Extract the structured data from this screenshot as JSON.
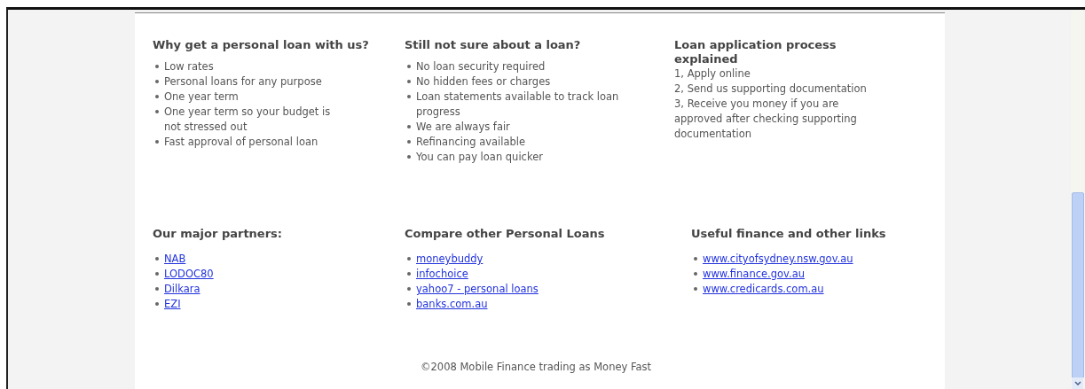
{
  "info_sections": [
    {
      "heading": "Why get a personal loan with us?",
      "kind": "bullets",
      "items": [
        "Low rates",
        "Personal loans for any purpose",
        "One year term",
        "One year term so your budget is not stressed out",
        "Fast approval of personal loan"
      ]
    },
    {
      "heading": "Still not sure about a loan?",
      "kind": "bullets",
      "items": [
        "No loan security required",
        "No hidden fees or charges",
        "Loan statements available to track loan progress",
        "We are always fair",
        "Refinancing available",
        "You can pay loan quicker"
      ]
    },
    {
      "heading": "Loan application process explained",
      "kind": "lines",
      "items": [
        "1, Apply online",
        "2, Send us supporting documentation",
        "3, Receive you money if you are approved after checking supporting documentation"
      ]
    }
  ],
  "link_sections": [
    {
      "heading": "Our major partners:",
      "kind": "links",
      "items": [
        "NAB",
        "LODOC80",
        "Dilkara",
        "EZI"
      ]
    },
    {
      "heading": "Compare other Personal Loans",
      "kind": "links",
      "items": [
        "moneybuddy",
        "infochoice",
        "yahoo7 - personal loans",
        "banks.com.au"
      ]
    },
    {
      "heading": "Useful finance and other links",
      "kind": "links",
      "items": [
        "www.cityofsydney.nsw.gov.au",
        "www.finance.gov.au",
        "www.credicards.com.au"
      ]
    }
  ],
  "footer": "©2008 Mobile Finance trading as Money Fast"
}
